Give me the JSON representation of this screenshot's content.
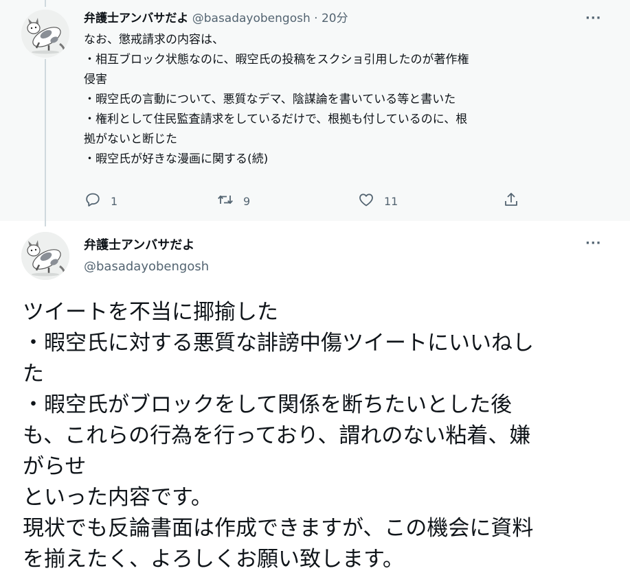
{
  "parent_tweet": {
    "display_name": "弁護士アンバサだよ",
    "handle": "@basadayobengosh",
    "separator": " · ",
    "time": "20分",
    "more_label": "···",
    "lines": [
      "なお、懲戒請求の内容は、",
      "・相互ブロック状態なのに、暇空氏の投稿をスクショ引用したのが著作権",
      "侵害",
      "・暇空氏の言動について、悪質なデマ、陰謀論を書いている等と書いた",
      "・権利として住民監査請求をしているだけで、根拠も付しているのに、根",
      "拠がないと断じた",
      "・暇空氏が好きな漫画に関する(続)"
    ],
    "actions": {
      "reply_count": "1",
      "retweet_count": "9",
      "like_count": "11"
    }
  },
  "main_tweet": {
    "display_name": "弁護士アンバサだよ",
    "handle": "@basadayobengosh",
    "more_label": "···",
    "lines": [
      "ツイートを不当に揶揄した",
      "・暇空氏に対する悪質な誹謗中傷ツイートにいいねし",
      "た",
      "・暇空氏がブロックをして関係を断ちたいとした後",
      "も、これらの行為を行っており、謂れのない粘着、嫌",
      "がらせ",
      "といった内容です。",
      "現状でも反論書面は作成できますが、この機会に資料",
      "を揃えたく、よろしくお願い致します。"
    ]
  },
  "icons": {
    "reply": "reply-icon",
    "retweet": "retweet-icon",
    "like": "heart-icon",
    "share": "share-icon",
    "more": "more-icon"
  },
  "colors": {
    "text_primary": "#0f1419",
    "text_secondary": "#536471",
    "parent_background": "#f7f9f9",
    "thread_line": "#cfd9de"
  }
}
